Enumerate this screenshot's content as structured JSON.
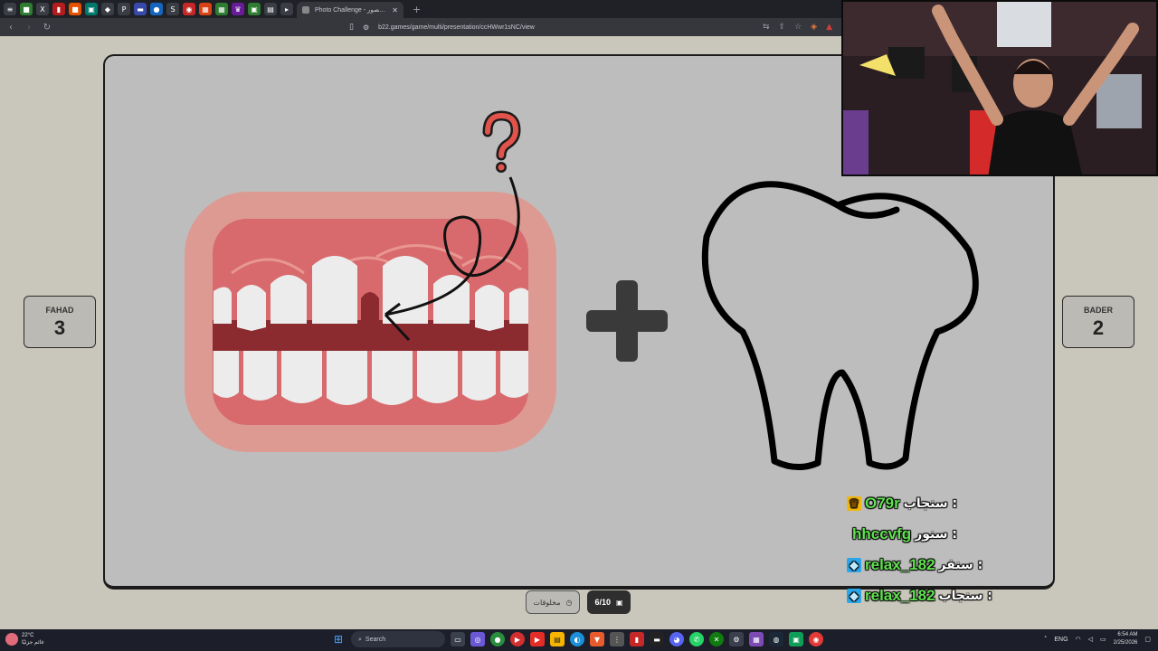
{
  "browser": {
    "active_tab_title": "Photo Challenge - تحدي الصور",
    "url": "b22.games/game/multi/presentation/ccHWwr1sNC/view",
    "tab_icons": [
      "menu-icon",
      "x-icon",
      "bolt-icon",
      "square-icon",
      "chat-icon",
      "diamond-icon",
      "p-icon",
      "mail-icon",
      "globe-icon",
      "s-icon",
      "eye-icon",
      "grid-icon",
      "gmail-icon",
      "bulb-icon",
      "crown-icon",
      "window-icon",
      "doc-icon",
      "pin-icon"
    ]
  },
  "players": {
    "left": {
      "name": "FAHAD",
      "score": "3"
    },
    "right": {
      "name": "BADER",
      "score": "2"
    }
  },
  "controls": {
    "category": "مخلوقات",
    "progress": "6/10"
  },
  "chat": [
    {
      "badge": "crown",
      "user": "O79r",
      "message": "سنجاب :"
    },
    {
      "badge": "",
      "user": "hhccvfg",
      "message": "سنور :"
    },
    {
      "badge": "cube",
      "user": "relax_182",
      "message": "سنفر :"
    },
    {
      "badge": "cube",
      "user": "relax_182",
      "message": "سنجاب :"
    }
  ],
  "taskbar": {
    "weather_temp": "22°C",
    "weather_desc": "غائم جزئيًا",
    "search_placeholder": "Search",
    "lang": "ENG",
    "time": "6:54 AM",
    "date": "2/25/2026"
  },
  "colors": {
    "chat_user": "#5fe34f",
    "stage_bg": "#bdbdbd",
    "gum": "#e57a78"
  }
}
